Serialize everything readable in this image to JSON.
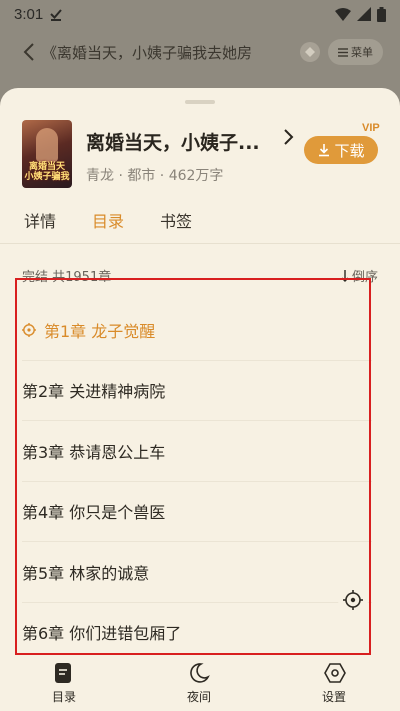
{
  "status": {
    "time": "3:01"
  },
  "reader": {
    "title": "《离婚当天，小姨子骗我去她房",
    "menu_label": "菜单"
  },
  "book": {
    "title": "离婚当天，小姨子...",
    "meta": "青龙 · 都市 · 462万字",
    "download_label": "下载",
    "vip_label": "VIP"
  },
  "tabs": [
    {
      "label": "详情"
    },
    {
      "label": "目录"
    },
    {
      "label": "书签"
    }
  ],
  "list": {
    "status": "完结 共1951章",
    "sort_label": "倒序"
  },
  "chapters": [
    {
      "label": "第1章 龙子觉醒"
    },
    {
      "label": "第2章 关进精神病院"
    },
    {
      "label": "第3章 恭请恩公上车"
    },
    {
      "label": "第4章 你只是个兽医"
    },
    {
      "label": "第5章 林家的诚意"
    },
    {
      "label": "第6章 你们进错包厢了"
    }
  ],
  "nav": [
    {
      "label": "目录",
      "icon": "book-icon"
    },
    {
      "label": "夜间",
      "icon": "moon-icon"
    },
    {
      "label": "设置",
      "icon": "gear-icon"
    }
  ],
  "colors": {
    "accent": "#d98b2a",
    "sheet": "#f7f1e3",
    "highlight": "#d81f1f"
  }
}
